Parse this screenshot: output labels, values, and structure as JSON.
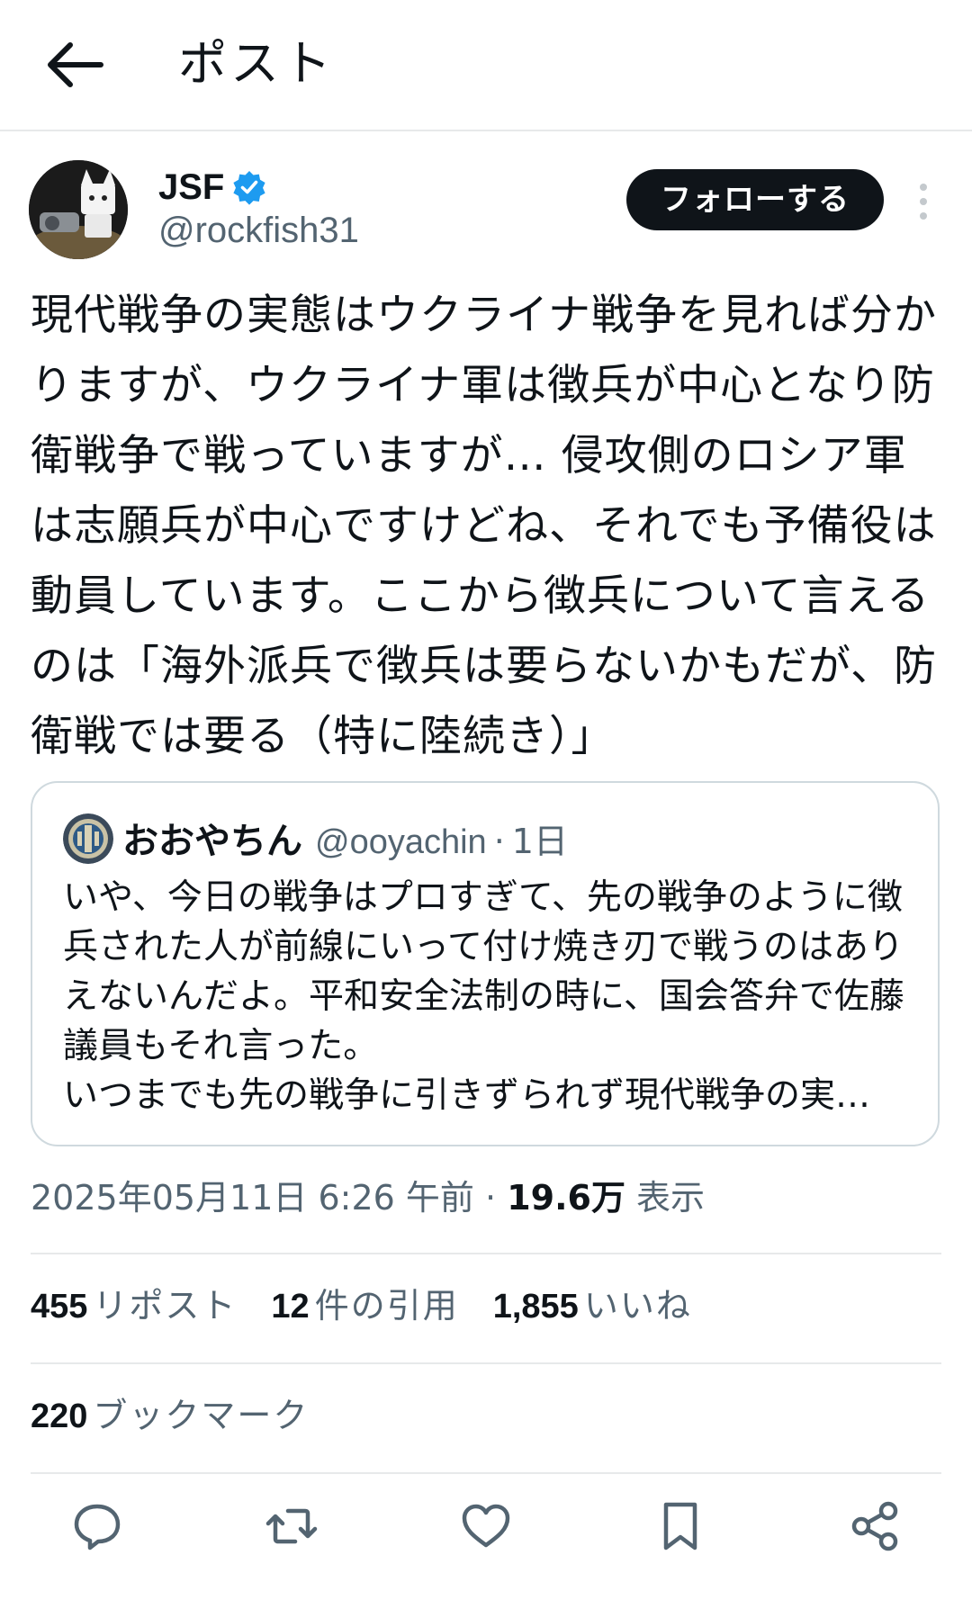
{
  "header": {
    "title": "ポスト",
    "back_icon": "arrow-left-icon"
  },
  "author": {
    "display_name": "JSF",
    "handle": "@rockfish31",
    "verified": true,
    "verified_color": "#1d9bf0",
    "follow_label": "フォローする"
  },
  "post": {
    "text": "現代戦争の実態はウクライナ戦争を見れば分かりますが、ウクライナ軍は徴兵が中心となり防衛戦争で戦っていますが… 侵攻側のロシア軍は志願兵が中心ですけどね、それでも予備役は動員しています。ここから徴兵について言えるのは「海外派兵で徴兵は要らないかもだが、防衛戦では要る（特に陸続き）」"
  },
  "quote": {
    "display_name": "おおやちん",
    "handle": "@ooyachin",
    "separator": "·",
    "time": "1日",
    "text": "いや、今日の戦争はプロすぎて、先の戦争のように徴兵された人が前線にいって付け焼き刃で戦うのはありえないんだよ。平和安全法制の時に、国会答弁で佐藤議員もそれ言った。\nいつまでも先の戦争に引きずられず現代戦争の実…"
  },
  "meta": {
    "datetime": "2025年05月11日 6:26 午前",
    "separator": "·",
    "views_count": "19.6万",
    "views_label": "表示"
  },
  "stats": {
    "reposts": {
      "count": "455",
      "label": "リポスト"
    },
    "quotes": {
      "count": "12",
      "label": "件の引用"
    },
    "likes": {
      "count": "1,855",
      "label": "いいね"
    },
    "bookmarks": {
      "count": "220",
      "label": "ブックマーク"
    }
  },
  "actions": [
    "reply-icon",
    "repost-icon",
    "like-icon",
    "bookmark-icon",
    "share-icon"
  ],
  "colors": {
    "text": "#0f1419",
    "secondary": "#536471",
    "border": "#e7e9ea",
    "accent": "#1d9bf0"
  }
}
